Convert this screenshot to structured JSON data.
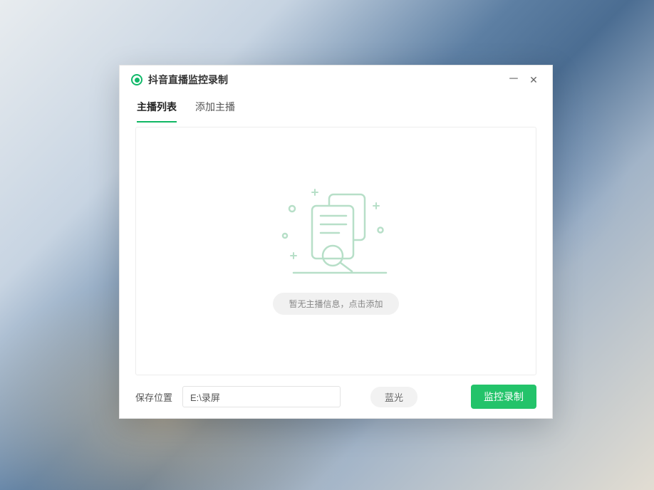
{
  "header": {
    "app_title": "抖音直播监控录制"
  },
  "tabs": [
    {
      "label": "主播列表",
      "active": true
    },
    {
      "label": "添加主播",
      "active": false
    }
  ],
  "empty": {
    "message": "暂无主播信息，点击添加"
  },
  "footer": {
    "save_label": "保存位置",
    "save_value": "E:\\录屏",
    "quality_label": "蓝光",
    "record_label": "监控录制"
  }
}
